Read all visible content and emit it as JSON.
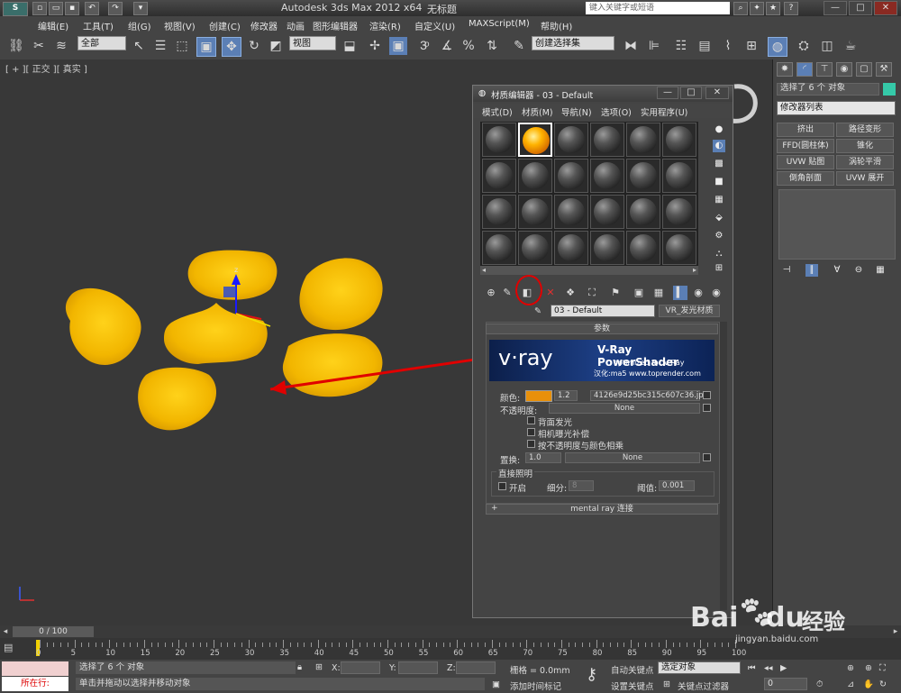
{
  "window": {
    "title_app": "Autodesk 3ds Max  2012 x64",
    "title_doc": "无标题",
    "search_placeholder": "键入关键字或短语",
    "min": "—",
    "max": "□",
    "close": "✕"
  },
  "menubar": [
    "编辑(E)",
    "工具(T)",
    "组(G)",
    "视图(V)",
    "创建(C)",
    "修改器",
    "动画",
    "图形编辑器",
    "渲染(R)",
    "自定义(U)",
    "MAXScript(M)",
    "帮助(H)"
  ],
  "toolbar": {
    "selection_filter": "全部",
    "ref_coord": "视图",
    "named_selection": "创建选择集"
  },
  "viewport": {
    "label": "[ + ][ 正交 ][ 真实 ]"
  },
  "material_editor": {
    "title": "材质编辑器 - 03 - Default",
    "menus": [
      "模式(D)",
      "材质(M)",
      "导航(N)",
      "选项(O)",
      "实用程序(U)"
    ],
    "material_name": "03 - Default",
    "material_type": "VR_发光材质",
    "params_header": "参数",
    "banner": {
      "brand": "v·ray",
      "title": "V-Ray PowerShader",
      "subtitle": "optimized for V-Ray",
      "credit": "汉化:ma5 www.toprender.com"
    },
    "color_label": "颜色:",
    "color_swatch": "#e8900a",
    "multiplier": "1.2",
    "texture_map": "4126e9d25bc315c607c36.jpg)",
    "opacity_label": "不透明度:",
    "opacity_map": "None",
    "options": [
      "背面发光",
      "相机曝光补偿",
      "按不透明度与颜色相乘"
    ],
    "displace_label": "置换:",
    "displace_value": "1.0",
    "displace_map": "None",
    "direct_light_label": "直接照明",
    "direct_on_label": "开启",
    "subdivs_label": "细分:",
    "subdivs_value": "8",
    "threshold_label": "阈值:",
    "threshold_value": "0.001",
    "mental_ray": "mental ray 连接",
    "plus": "+"
  },
  "command_panel": {
    "selection_info": "选择了 6 个 对象",
    "modifier_list": "修改器列表",
    "buttons": [
      "挤出",
      "路径变形",
      "FFD(圆柱体)",
      "锥化",
      "UVW 贴图",
      "涡轮平滑",
      "倒角剖面",
      "UVW 展开"
    ],
    "object_color": "#35c9a8"
  },
  "timeline": {
    "frame_display": "0 / 100",
    "ticks": [
      "0",
      "5",
      "10",
      "15",
      "20",
      "25",
      "30",
      "35",
      "40",
      "45",
      "50",
      "55",
      "60",
      "65",
      "70",
      "75",
      "80",
      "85",
      "90",
      "95",
      "100"
    ]
  },
  "status": {
    "maxscript_label": "所在行:",
    "selected_msg": "选择了 6 个 对象",
    "prompt": "单击并拖动以选择并移动对象",
    "x_label": "X:",
    "y_label": "Y:",
    "z_label": "Z:",
    "grid": "栅格 = 0.0mm",
    "add_time_tag": "添加时间标记",
    "auto_key": "自动关键点",
    "set_key": "设置关键点",
    "selected_obj": "选定对象",
    "key_filters": "关键点过滤器",
    "frame_field": "0"
  },
  "watermark": {
    "brand_a": "Bai",
    "brand_b": "du",
    "brand_c": "经验",
    "url": "jingyan.baidu.com"
  }
}
